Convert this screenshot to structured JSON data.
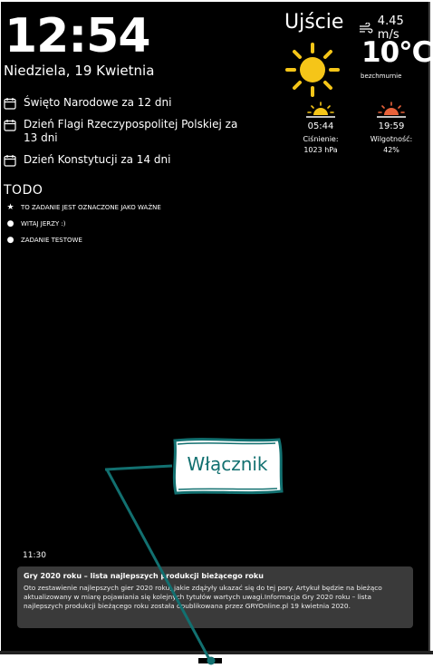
{
  "clock": {
    "time": "12:54",
    "date": "Niedziela, 19 Kwietnia"
  },
  "calendar": {
    "icon": "calendar-icon",
    "events": [
      {
        "label": "Święto Narodowe za 12 dni"
      },
      {
        "label": "Dzień Flagi Rzeczypospolitej Polskiej za 13 dni"
      },
      {
        "label": "Dzień Konstytucji za 14 dni"
      }
    ]
  },
  "todo": {
    "title": "TODO",
    "items": [
      {
        "mark": "star-icon",
        "label": "TO ZADANIE JEST OZNACZONE JAKO WAŻNE"
      },
      {
        "mark": "bullet-icon",
        "label": "WITAJ JERZY :)"
      },
      {
        "mark": "bullet-icon",
        "label": "ZADANIE TESTOWE"
      }
    ]
  },
  "weather": {
    "location": "Ujście",
    "wind": "4.45 m/s",
    "temperature": "10°C",
    "condition": "bezchmurnie",
    "sun_color": "#f5c518",
    "sunrise": {
      "time": "05:44",
      "label": "Ciśnienie:",
      "value": "1023 hPa",
      "color": "#f5c518"
    },
    "sunset": {
      "time": "19:59",
      "label": "Wilgotność:",
      "value": "42%",
      "color": "#e8623a"
    }
  },
  "news": {
    "time": "11:30",
    "title": "Gry 2020 roku – lista najlepszych produkcji bieżącego roku",
    "body": "Oto zestawienie najlepszych gier 2020 roku, jakie zdążyły ukazać się do tej pory. Artykuł będzie na bieżąco aktualizowany w miarę pojawiania się kolejnych tytułów wartych uwagi.Informacja Gry 2020 roku – lista najlepszych produkcji bieżącego roku została opublikowana przez GRYOnline.pl 19 kwietnia 2020."
  },
  "annotation": {
    "label": "Włącznik",
    "color": "#127070"
  }
}
